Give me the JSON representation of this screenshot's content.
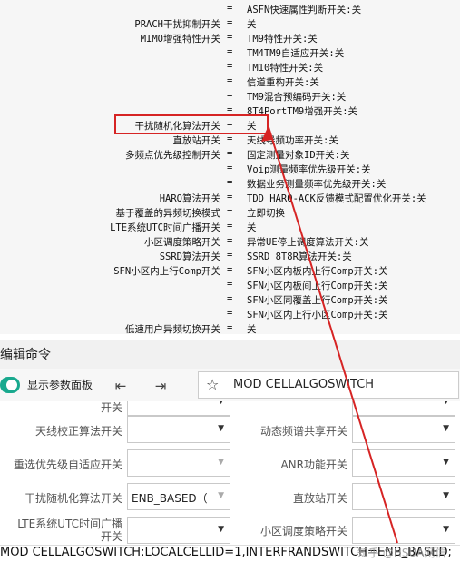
{
  "listing": [
    {
      "name": "",
      "eq": "=",
      "value": "ASFN快速属性判断开关:关"
    },
    {
      "name": "PRACH干扰抑制开关",
      "eq": "=",
      "value": "关"
    },
    {
      "name": "MIMO增强特性开关",
      "eq": "=",
      "value": "TM9特性开关:关"
    },
    {
      "name": "",
      "eq": "=",
      "value": "TM4TM9自适应开关:关"
    },
    {
      "name": "",
      "eq": "=",
      "value": "TM10特性开关:关"
    },
    {
      "name": "",
      "eq": "=",
      "value": "信道重构开关:关"
    },
    {
      "name": "",
      "eq": "=",
      "value": "TM9混合预编码开关:关"
    },
    {
      "name": "",
      "eq": "=",
      "value": "8T4PortTM9增强开关:关"
    },
    {
      "name": "干扰随机化算法开关",
      "eq": "=",
      "value": "关"
    },
    {
      "name": "直放站开关",
      "eq": "=",
      "value": "天线导频功率开关:关"
    },
    {
      "name": "多频点优先级控制开关",
      "eq": "=",
      "value": "固定测量对象ID开关:关"
    },
    {
      "name": "",
      "eq": "=",
      "value": "Voip测量频率优先级开关:关"
    },
    {
      "name": "",
      "eq": "=",
      "value": "数据业务测量频率优先级开关:关"
    },
    {
      "name": "HARQ算法开关",
      "eq": "=",
      "value": "TDD HARQ-ACK反馈模式配置优化开关:关"
    },
    {
      "name": "基于覆盖的异频切换模式",
      "eq": "=",
      "value": "立即切换"
    },
    {
      "name": "LTE系统UTC时间广播开关",
      "eq": "=",
      "value": "关"
    },
    {
      "name": "小区调度策略开关",
      "eq": "=",
      "value": "异常UE停止调度算法开关:关"
    },
    {
      "name": "SSRD算法开关",
      "eq": "=",
      "value": "SSRD 8T8R算法开关:关"
    },
    {
      "name": "SFN小区内上行Comp开关",
      "eq": "=",
      "value": "SFN小区内板内上行Comp开关:关"
    },
    {
      "name": "",
      "eq": "=",
      "value": "SFN小区内板间上行Comp开关:关"
    },
    {
      "name": "",
      "eq": "=",
      "value": "SFN小区同覆盖上行Comp开关:关"
    },
    {
      "name": "",
      "eq": "=",
      "value": "SFN小区内上行小区Comp开关:关"
    },
    {
      "name": "低速用户异频切换开关",
      "eq": "=",
      "value": "关"
    }
  ],
  "panel": {
    "title": "编辑命令"
  },
  "toolbar": {
    "toggle_label": "显示参数面板",
    "command": "MOD CELLALGOSWITCH",
    "toggle_color": "#19a98e"
  },
  "form": {
    "left": [
      {
        "label": "开关",
        "value": "",
        "enabled": true
      },
      {
        "label": "天线校正算法开关",
        "value": "",
        "enabled": true
      },
      {
        "label": "重选优先级自适应开关",
        "value": "",
        "enabled": false
      },
      {
        "label": "干扰随机化算法开关",
        "value": "ENB_BASED（",
        "enabled": false
      },
      {
        "label": "LTE系统UTC时间广播开关",
        "value": "",
        "enabled": true
      }
    ],
    "right": [
      {
        "label": "",
        "value": "",
        "enabled": true
      },
      {
        "label": "动态频谱共享开关",
        "value": "",
        "enabled": true
      },
      {
        "label": "ANR功能开关",
        "value": "",
        "enabled": true
      },
      {
        "label": "直放站开关",
        "value": "",
        "enabled": true
      },
      {
        "label": "小区调度策略开关",
        "value": "",
        "enabled": true
      }
    ]
  },
  "command_line": "MOD CELLALGOSWITCH:LOCALCELLID=1,INTERFRANDSWITCH=ENB_BASED;",
  "watermark": "知乎 @HSUA网信",
  "colors": {
    "highlight": "#d62424"
  }
}
